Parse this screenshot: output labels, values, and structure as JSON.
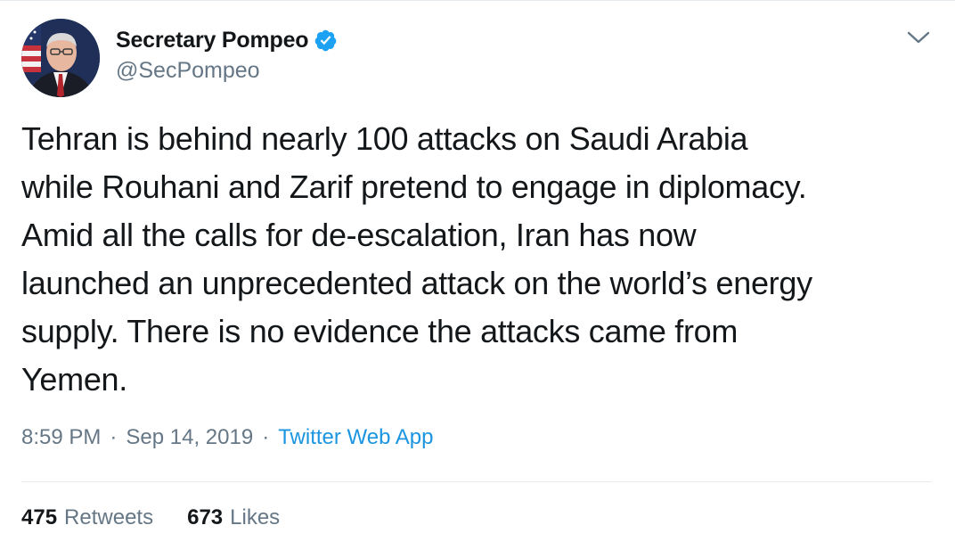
{
  "user": {
    "display_name": "Secretary Pompeo",
    "handle": "@SecPompeo",
    "verified": true
  },
  "tweet": {
    "text": "Tehran is behind nearly 100 attacks on Saudi Arabia\nwhile Rouhani and Zarif pretend to engage in diplomacy.\nAmid all the calls for de-escalation, Iran has now\nlaunched an unprecedented attack on the world’s energy\nsupply.  There is no evidence the attacks came from\nYemen.",
    "time": "8:59 PM",
    "date": "Sep 14, 2019",
    "source": "Twitter Web App",
    "separator": "·"
  },
  "stats": {
    "retweets_count": "475",
    "retweets_label": "Retweets",
    "likes_count": "673",
    "likes_label": "Likes"
  },
  "icons": {
    "verified": "verified-badge-icon",
    "menu": "chevron-down-icon"
  },
  "colors": {
    "text": "#14171a",
    "secondary": "#657786",
    "link": "#1b95e0",
    "verified": "#1da1f2",
    "divider": "#e6ecf0"
  }
}
